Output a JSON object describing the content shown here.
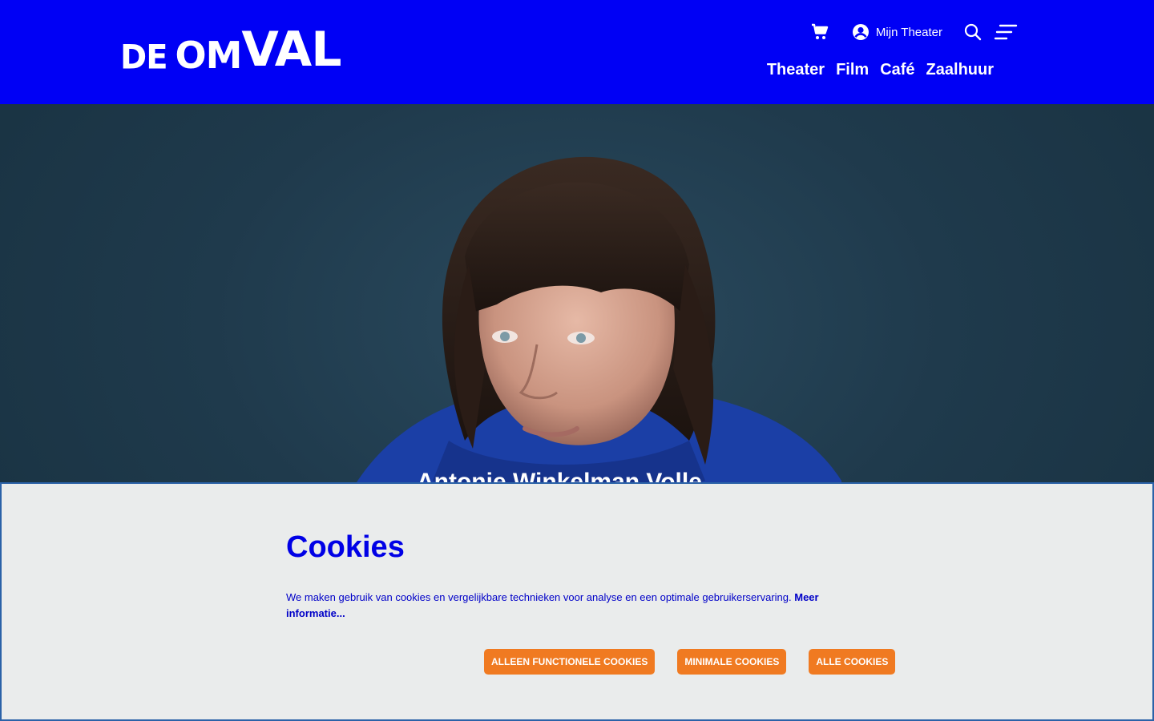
{
  "header": {
    "logo": {
      "part1": "DE",
      "part2": "OM",
      "part3": "VAL"
    },
    "account_label": "Mijn Theater",
    "nav": [
      "Theater",
      "Film",
      "Café",
      "Zaalhuur"
    ]
  },
  "hero": {
    "caption": "Antonie Winkelman Volle"
  },
  "cookie": {
    "title": "Cookies",
    "text": "We maken gebruik van cookies en vergelijkbare technieken voor analyse en een optimale gebruikerservaring.",
    "more_link": "Meer informatie...",
    "buttons": [
      "Alleen functionele cookies",
      "Minimale cookies",
      "Alle cookies"
    ]
  },
  "colors": {
    "header_bg": "#0000f5",
    "accent_button": "#f07a21",
    "cookie_text": "#0000c8"
  }
}
